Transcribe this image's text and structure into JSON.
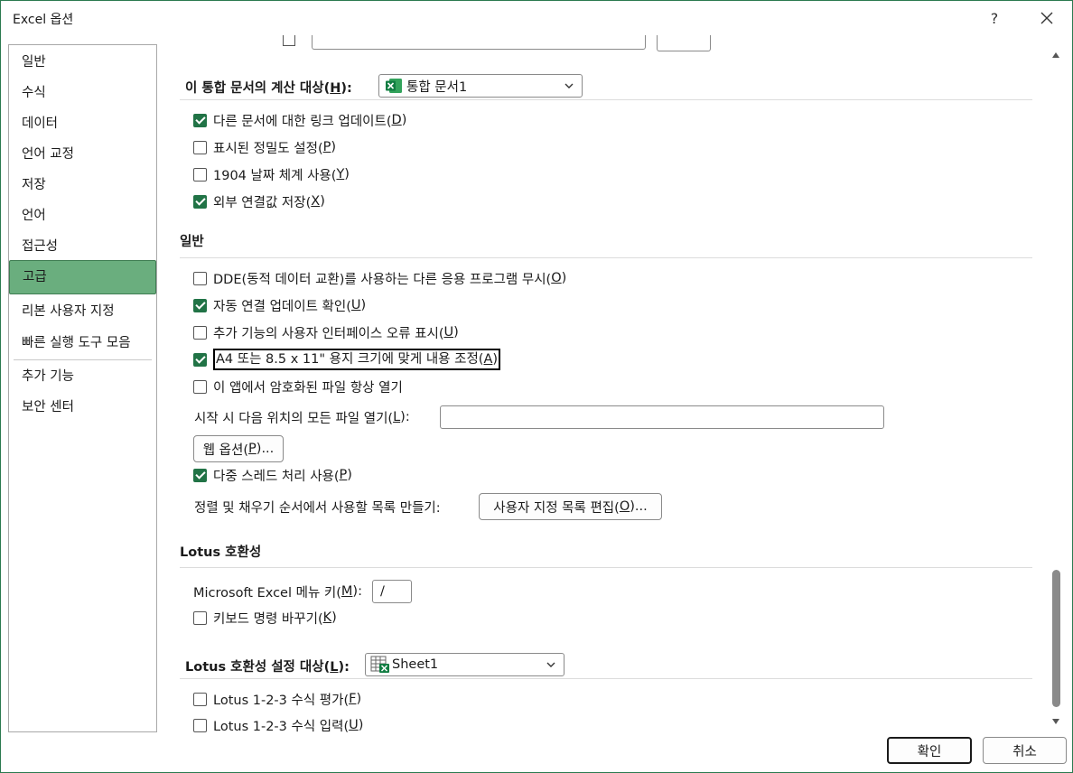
{
  "window": {
    "title": "Excel 옵션",
    "help": "?",
    "close": "✕"
  },
  "sidebar": {
    "items": [
      {
        "label": "일반"
      },
      {
        "label": "수식"
      },
      {
        "label": "데이터"
      },
      {
        "label": "언어 교정"
      },
      {
        "label": "저장"
      },
      {
        "label": "언어"
      },
      {
        "label": "접근성"
      },
      {
        "label": "고급",
        "selected": true
      },
      {
        "label": "리본 사용자 지정"
      },
      {
        "label": "빠른 실행 도구 모음"
      },
      {
        "label": "추가 기능"
      },
      {
        "label": "보안 센터"
      }
    ]
  },
  "workbook_calc": {
    "label_pre": "이 통합 문서의 계산 대상(",
    "label_key": "H",
    "label_post": "):",
    "selected": "통합 문서1",
    "options": [
      {
        "pre": "다른 문서에 대한 링크 업데이트(",
        "key": "D",
        "post": ")",
        "checked": true
      },
      {
        "pre": "표시된 정밀도 설정(",
        "key": "P",
        "post": ")",
        "checked": false
      },
      {
        "pre": "1904 날짜 체계 사용(",
        "key": "Y",
        "post": ")",
        "checked": false
      },
      {
        "pre": "외부 연결값 저장(",
        "key": "X",
        "post": ")",
        "checked": true
      }
    ]
  },
  "general": {
    "heading": "일반",
    "options": [
      {
        "pre": "DDE(동적 데이터 교환)를 사용하는 다른 응용 프로그램 무시(",
        "key": "O",
        "post": ")",
        "checked": false
      },
      {
        "pre": "자동 연결 업데이트 확인(",
        "key": "U",
        "post": ")",
        "checked": true
      },
      {
        "pre": "추가 기능의 사용자 인터페이스 오류 표시(",
        "key": "U",
        "post": ")",
        "checked": false
      },
      {
        "pre": "A4 또는 8.5 x 11\" 용지 크기에 맞게 내용 조정(",
        "key": "A",
        "post": ")",
        "checked": true
      },
      {
        "pre": "이 앱에서 암호화된 파일 항상 열기",
        "key": "",
        "post": "",
        "checked": false
      }
    ],
    "startup_label_pre": "시작 시 다음 위치의 모든 파일 열기(",
    "startup_label_key": "L",
    "startup_label_post": "):",
    "startup_value": "",
    "web_options_pre": "웹 옵션(",
    "web_options_key": "P",
    "web_options_post": ")...",
    "multithread": {
      "pre": "다중 스레드 처리 사용(",
      "key": "P",
      "post": ")",
      "checked": true
    },
    "sort_label": "정렬 및 채우기 순서에서 사용할 목록 만들기:",
    "custom_list_pre": "사용자 지정 목록 편집(",
    "custom_list_key": "O",
    "custom_list_post": ")..."
  },
  "lotus": {
    "heading": "Lotus 호환성",
    "menu_key_pre": "Microsoft Excel 메뉴 키(",
    "menu_key_key": "M",
    "menu_key_post": "):",
    "menu_key_value": "/",
    "nav_keys": {
      "pre": "키보드 명령 바꾸기(",
      "key": "K",
      "post": ")",
      "checked": false
    }
  },
  "lotus_settings": {
    "label_pre": "Lotus 호환성 설정 대상(",
    "label_key": "L",
    "label_post": "):",
    "selected": "Sheet1",
    "options": [
      {
        "pre": "Lotus 1-2-3 수식 평가(",
        "key": "F",
        "post": ")",
        "checked": false
      },
      {
        "pre": "Lotus 1-2-3 수식 입력(",
        "key": "U",
        "post": ")",
        "checked": false
      }
    ]
  },
  "footer": {
    "ok": "확인",
    "cancel": "취소"
  },
  "colors": {
    "accent": "#217346",
    "nav_selected": "#6aae7e",
    "border": "#2c7a50"
  }
}
